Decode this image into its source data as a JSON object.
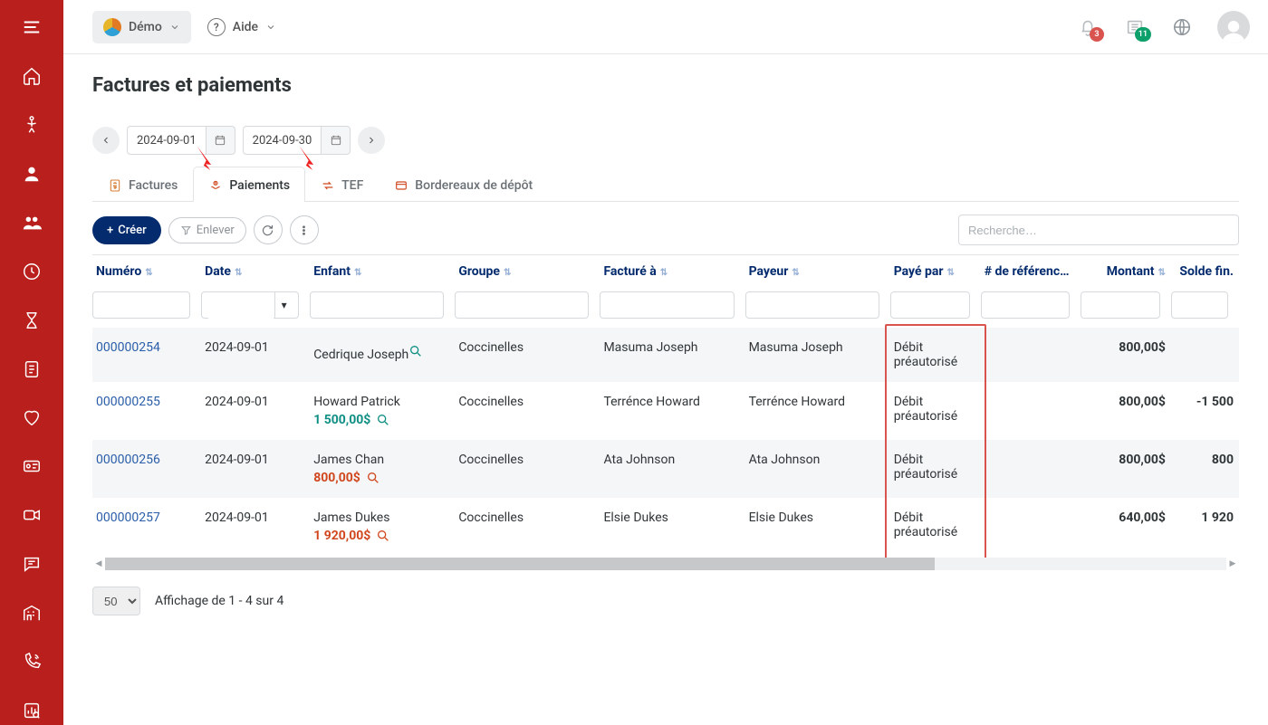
{
  "topbar": {
    "env_label": "Démo",
    "help_label": "Aide",
    "notif_count": "3",
    "news_count": "11"
  },
  "page": {
    "title": "Factures et paiements"
  },
  "date_range": {
    "start": "2024-09-01",
    "end": "2024-09-30"
  },
  "tabs": {
    "factures": "Factures",
    "paiements": "Paiements",
    "tef": "TEF",
    "bordereaux": "Bordereaux de dépôt",
    "active": "paiements"
  },
  "toolbar": {
    "create": "Créer",
    "remove": "Enlever",
    "search_placeholder": "Recherche…"
  },
  "columns": {
    "numero": "Numéro",
    "date": "Date",
    "enfant": "Enfant",
    "groupe": "Groupe",
    "facture_a": "Facturé à",
    "payeur": "Payeur",
    "paye_par": "Payé par",
    "ref": "# de référence",
    "montant": "Montant",
    "solde": "Solde fin."
  },
  "rows": [
    {
      "numero": "000000254",
      "date": "2024-09-01",
      "enfant": "Cedrique Joseph",
      "enfant_sub": "",
      "enfant_sub_color": "teal",
      "groupe": "Coccinelles",
      "facture_a": "Masuma Joseph",
      "payeur": "Masuma Joseph",
      "paye_par": "Débit préautorisé",
      "ref": "",
      "montant": "800,00$",
      "solde": ""
    },
    {
      "numero": "000000255",
      "date": "2024-09-01",
      "enfant": "Howard Patrick",
      "enfant_sub": "1 500,00$",
      "enfant_sub_color": "green",
      "groupe": "Coccinelles",
      "facture_a": "Terrénce Howard",
      "payeur": "Terrénce Howard",
      "paye_par": "Débit préautorisé",
      "ref": "",
      "montant": "800,00$",
      "solde": "-1 500"
    },
    {
      "numero": "000000256",
      "date": "2024-09-01",
      "enfant": "James Chan",
      "enfant_sub": "800,00$",
      "enfant_sub_color": "red",
      "groupe": "Coccinelles",
      "facture_a": "Ata Johnson",
      "payeur": "Ata Johnson",
      "paye_par": "Débit préautorisé",
      "ref": "",
      "montant": "800,00$",
      "solde": "800"
    },
    {
      "numero": "000000257",
      "date": "2024-09-01",
      "enfant": "James Dukes",
      "enfant_sub": "1 920,00$",
      "enfant_sub_color": "red",
      "groupe": "Coccinelles",
      "facture_a": "Elsie Dukes",
      "payeur": "Elsie Dukes",
      "paye_par": "Débit préautorisé",
      "ref": "",
      "montant": "640,00$",
      "solde": "1 920"
    }
  ],
  "paging": {
    "page_size": "50",
    "info": "Affichage de 1 - 4 sur 4"
  }
}
